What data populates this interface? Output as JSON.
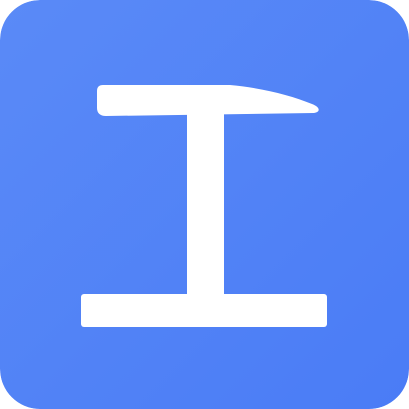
{
  "icon": {
    "name": "hammer-i-beam-icon",
    "background_color_start": "#5A8AF7",
    "background_color_end": "#4A7CF6",
    "glyph_color": "#FFFFFF"
  }
}
